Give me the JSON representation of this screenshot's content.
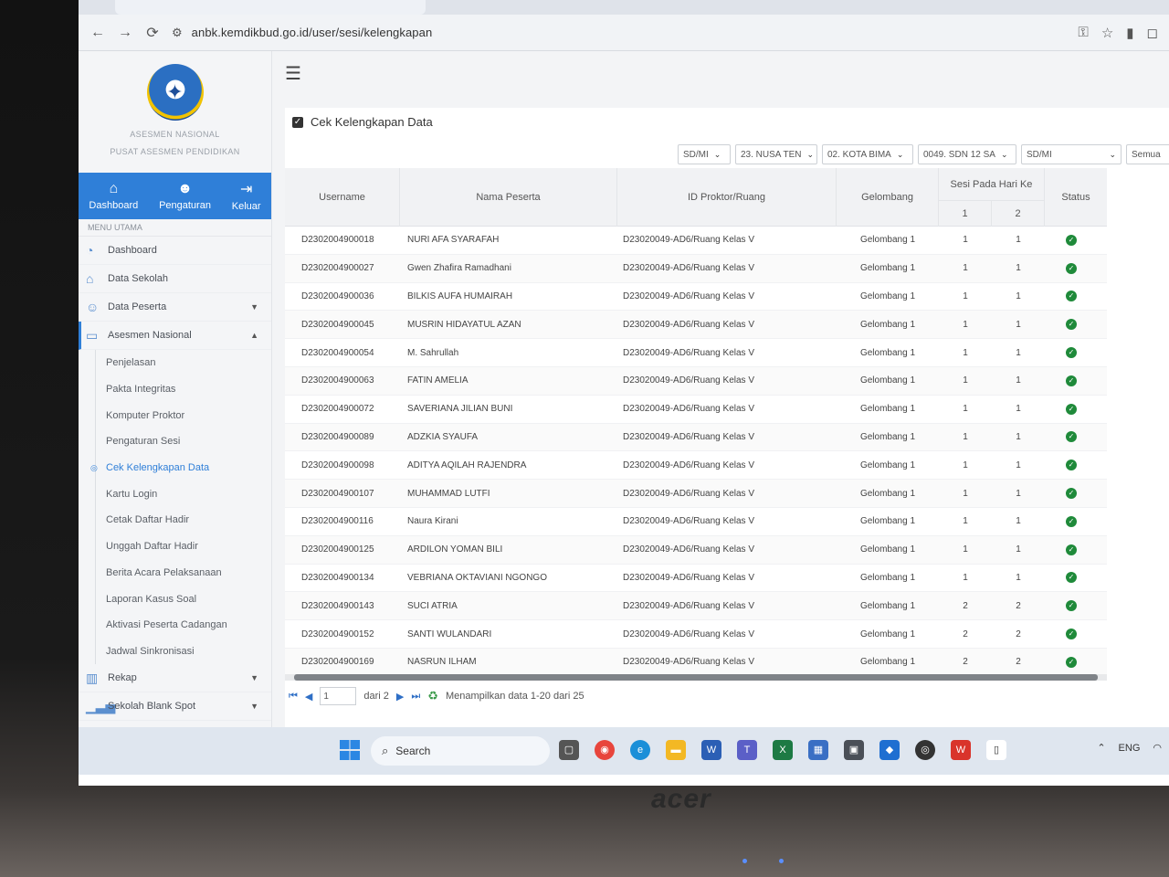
{
  "browser": {
    "url": "anbk.kemdikbud.go.id/user/sesi/kelengkapan"
  },
  "sidebar": {
    "logo_title": "ASESMEN NASIONAL",
    "logo_subtitle": "PUSAT ASESMEN PENDIDIKAN",
    "topnav": [
      {
        "label": "Dashboard",
        "icon": "home-icon"
      },
      {
        "label": "Pengaturan",
        "icon": "users-gear-icon"
      },
      {
        "label": "Keluar",
        "icon": "sign-out-icon"
      }
    ],
    "menu_heading": "MENU UTAMA",
    "menu": {
      "dashboard": "Dashboard",
      "data_sekolah": "Data Sekolah",
      "data_peserta": "Data Peserta",
      "asesmen_nasional": "Asesmen Nasional",
      "rekap": "Rekap",
      "sekolah_blank_spot": "Sekolah Blank Spot"
    },
    "submenu": [
      "Penjelasan",
      "Pakta Integritas",
      "Komputer Proktor",
      "Pengaturan Sesi",
      "Cek Kelengkapan Data",
      "Kartu Login",
      "Cetak Daftar Hadir",
      "Unggah Daftar Hadir",
      "Berita Acara Pelaksanaan",
      "Laporan Kasus Soal",
      "Aktivasi Peserta Cadangan",
      "Jadwal Sinkronisasi"
    ]
  },
  "main": {
    "title": "Cek Kelengkapan Data",
    "filters": [
      "SD/MI",
      "23. NUSA TEN",
      "02. KOTA BIMA",
      "0049. SDN 12 SA",
      "SD/MI",
      "Semua"
    ],
    "columns": {
      "username": "Username",
      "nama": "Nama Peserta",
      "id_proktor": "ID Proktor/Ruang",
      "gelombang": "Gelombang",
      "sesi": "Sesi Pada Hari Ke",
      "sesi_1": "1",
      "sesi_2": "2",
      "status": "Status"
    },
    "rows": [
      {
        "username": "D2302004900018",
        "nama": "NURI AFA SYARAFAH",
        "id": "D23020049-AD6/Ruang Kelas V",
        "gel": "Gelombang 1",
        "s1": "1",
        "s2": "1"
      },
      {
        "username": "D2302004900027",
        "nama": "Gwen Zhafira Ramadhani",
        "id": "D23020049-AD6/Ruang Kelas V",
        "gel": "Gelombang 1",
        "s1": "1",
        "s2": "1"
      },
      {
        "username": "D2302004900036",
        "nama": "BILKIS AUFA HUMAIRAH",
        "id": "D23020049-AD6/Ruang Kelas V",
        "gel": "Gelombang 1",
        "s1": "1",
        "s2": "1"
      },
      {
        "username": "D2302004900045",
        "nama": "MUSRIN HIDAYATUL AZAN",
        "id": "D23020049-AD6/Ruang Kelas V",
        "gel": "Gelombang 1",
        "s1": "1",
        "s2": "1"
      },
      {
        "username": "D2302004900054",
        "nama": "M. Sahrullah",
        "id": "D23020049-AD6/Ruang Kelas V",
        "gel": "Gelombang 1",
        "s1": "1",
        "s2": "1"
      },
      {
        "username": "D2302004900063",
        "nama": "FATIN AMELIA",
        "id": "D23020049-AD6/Ruang Kelas V",
        "gel": "Gelombang 1",
        "s1": "1",
        "s2": "1"
      },
      {
        "username": "D2302004900072",
        "nama": "SAVERIANA JILIAN BUNI",
        "id": "D23020049-AD6/Ruang Kelas V",
        "gel": "Gelombang 1",
        "s1": "1",
        "s2": "1"
      },
      {
        "username": "D2302004900089",
        "nama": "ADZKIA SYAUFA",
        "id": "D23020049-AD6/Ruang Kelas V",
        "gel": "Gelombang 1",
        "s1": "1",
        "s2": "1"
      },
      {
        "username": "D2302004900098",
        "nama": "ADITYA AQILAH RAJENDRA",
        "id": "D23020049-AD6/Ruang Kelas V",
        "gel": "Gelombang 1",
        "s1": "1",
        "s2": "1"
      },
      {
        "username": "D2302004900107",
        "nama": "MUHAMMAD LUTFI",
        "id": "D23020049-AD6/Ruang Kelas V",
        "gel": "Gelombang 1",
        "s1": "1",
        "s2": "1"
      },
      {
        "username": "D2302004900116",
        "nama": "Naura Kirani",
        "id": "D23020049-AD6/Ruang Kelas V",
        "gel": "Gelombang 1",
        "s1": "1",
        "s2": "1"
      },
      {
        "username": "D2302004900125",
        "nama": "ARDILON YOMAN BILI",
        "id": "D23020049-AD6/Ruang Kelas V",
        "gel": "Gelombang 1",
        "s1": "1",
        "s2": "1"
      },
      {
        "username": "D2302004900134",
        "nama": "VEBRIANA OKTAVIANI NGONGO",
        "id": "D23020049-AD6/Ruang Kelas V",
        "gel": "Gelombang 1",
        "s1": "1",
        "s2": "1"
      },
      {
        "username": "D2302004900143",
        "nama": "SUCI ATRIA",
        "id": "D23020049-AD6/Ruang Kelas V",
        "gel": "Gelombang 1",
        "s1": "2",
        "s2": "2"
      },
      {
        "username": "D2302004900152",
        "nama": "SANTI WULANDARI",
        "id": "D23020049-AD6/Ruang Kelas V",
        "gel": "Gelombang 1",
        "s1": "2",
        "s2": "2"
      },
      {
        "username": "D2302004900169",
        "nama": "NASRUN ILHAM",
        "id": "D23020049-AD6/Ruang Kelas V",
        "gel": "Gelombang 1",
        "s1": "2",
        "s2": "2"
      }
    ],
    "pager": {
      "page": "1",
      "of_label": "dari 2",
      "summary": "Menampilkan data 1-20 dari 25"
    }
  },
  "taskbar": {
    "search_label": "Search",
    "lang": "ENG"
  },
  "brand": "acer",
  "colors": {
    "accent": "#2f7fd8",
    "status_ok": "#1f8a3a"
  }
}
